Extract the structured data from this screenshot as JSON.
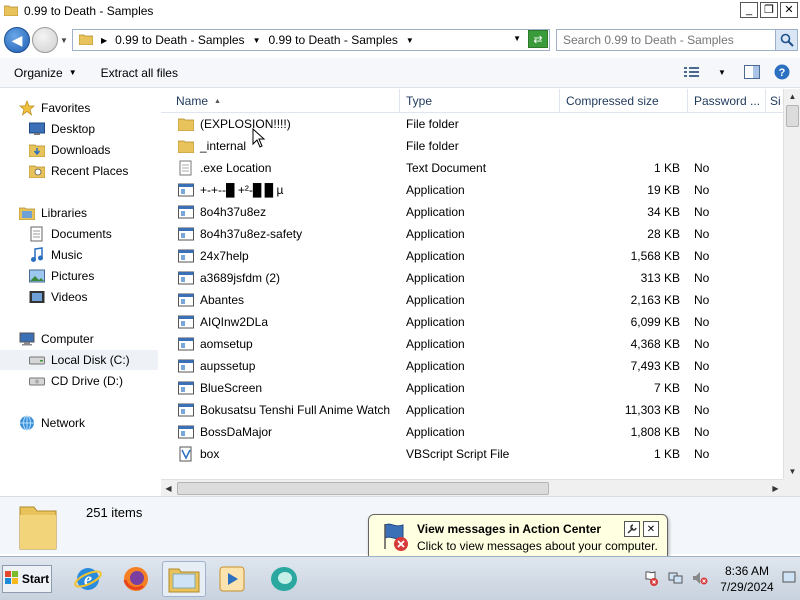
{
  "window": {
    "title": "0.99 to Death - Samples",
    "controls": {
      "minimize": "_",
      "maximize": "❐",
      "close": "✕"
    }
  },
  "address": {
    "crumbs": [
      "0.99 to Death - Samples",
      "0.99 to Death - Samples"
    ],
    "search_placeholder": "Search 0.99 to Death - Samples"
  },
  "toolbar": {
    "organize_label": "Organize",
    "extract_label": "Extract all files"
  },
  "nav": {
    "favorites": "Favorites",
    "desktop": "Desktop",
    "downloads": "Downloads",
    "recent_places": "Recent Places",
    "libraries": "Libraries",
    "documents": "Documents",
    "music": "Music",
    "pictures": "Pictures",
    "videos": "Videos",
    "computer": "Computer",
    "local_disk": "Local Disk (C:)",
    "cd_drive": "CD Drive (D:)",
    "network": "Network"
  },
  "columns": {
    "name": "Name",
    "type": "Type",
    "compressed_size": "Compressed size",
    "password": "Password ...",
    "size": "Si"
  },
  "files": [
    {
      "name": "(EXPLOSION!!!!)",
      "type": "File folder",
      "size": "",
      "password": "",
      "icon": "folder-icon"
    },
    {
      "name": "_internal",
      "type": "File folder",
      "size": "",
      "password": "",
      "icon": "folder-icon"
    },
    {
      "name": ".exe Location",
      "type": "Text Document",
      "size": "1 KB",
      "password": "No",
      "icon": "text-document-icon"
    },
    {
      "name": "+-+--█ +²-█ █ µ",
      "type": "Application",
      "size": "19 KB",
      "password": "No",
      "icon": "application-icon"
    },
    {
      "name": "8o4h37u8ez",
      "type": "Application",
      "size": "34 KB",
      "password": "No",
      "icon": "application-icon"
    },
    {
      "name": "8o4h37u8ez-safety",
      "type": "Application",
      "size": "28 KB",
      "password": "No",
      "icon": "application-icon"
    },
    {
      "name": "24x7help",
      "type": "Application",
      "size": "1,568 KB",
      "password": "No",
      "icon": "application-icon"
    },
    {
      "name": "a3689jsfdm (2)",
      "type": "Application",
      "size": "313 KB",
      "password": "No",
      "icon": "application-icon"
    },
    {
      "name": "Abantes",
      "type": "Application",
      "size": "2,163 KB",
      "password": "No",
      "icon": "application-icon"
    },
    {
      "name": "AIQInw2DLa",
      "type": "Application",
      "size": "6,099 KB",
      "password": "No",
      "icon": "application-icon"
    },
    {
      "name": "aomsetup",
      "type": "Application",
      "size": "4,368 KB",
      "password": "No",
      "icon": "application-icon"
    },
    {
      "name": "aupssetup",
      "type": "Application",
      "size": "7,493 KB",
      "password": "No",
      "icon": "application-icon"
    },
    {
      "name": "BlueScreen",
      "type": "Application",
      "size": "7 KB",
      "password": "No",
      "icon": "application-icon"
    },
    {
      "name": "Bokusatsu Tenshi Full Anime Watch",
      "type": "Application",
      "size": "11,303 KB",
      "password": "No",
      "icon": "application-icon"
    },
    {
      "name": "BossDaMajor",
      "type": "Application",
      "size": "1,808 KB",
      "password": "No",
      "icon": "application-icon"
    },
    {
      "name": "box",
      "type": "VBScript Script File",
      "size": "1 KB",
      "password": "No",
      "icon": "vbscript-icon"
    }
  ],
  "details": {
    "item_count": "251 items"
  },
  "notification": {
    "title": "View messages in Action Center",
    "message": "Click to view messages about your computer."
  },
  "taskbar": {
    "start_label": "Start",
    "time": "8:36 AM",
    "date": "7/29/2024"
  }
}
